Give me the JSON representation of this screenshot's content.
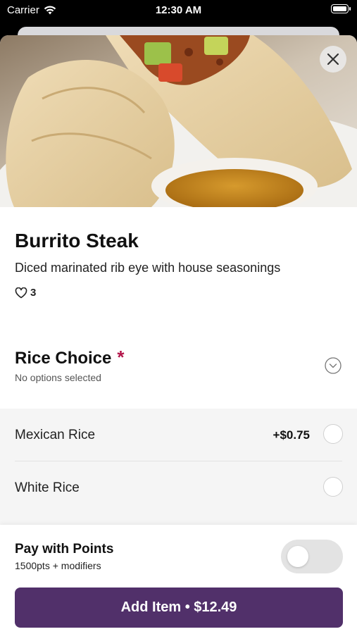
{
  "status_bar": {
    "carrier": "Carrier",
    "time": "12:30 AM"
  },
  "item": {
    "name": "Burrito Steak",
    "description": "Diced marinated rib eye with house seasonings",
    "like_count": "3"
  },
  "rice_choice": {
    "title": "Rice Choice",
    "required_mark": "*",
    "subtitle": "No options selected",
    "options": [
      {
        "label": "Mexican Rice",
        "price": "+$0.75",
        "selected": false
      },
      {
        "label": "White Rice",
        "price": "",
        "selected": false
      }
    ]
  },
  "pay_points": {
    "title": "Pay with Points",
    "subtitle": "1500pts + modifiers",
    "enabled": false
  },
  "add_button": {
    "label": "Add Item • $12.49"
  },
  "colors": {
    "accent": "#51306a",
    "required": "#b3154a"
  }
}
